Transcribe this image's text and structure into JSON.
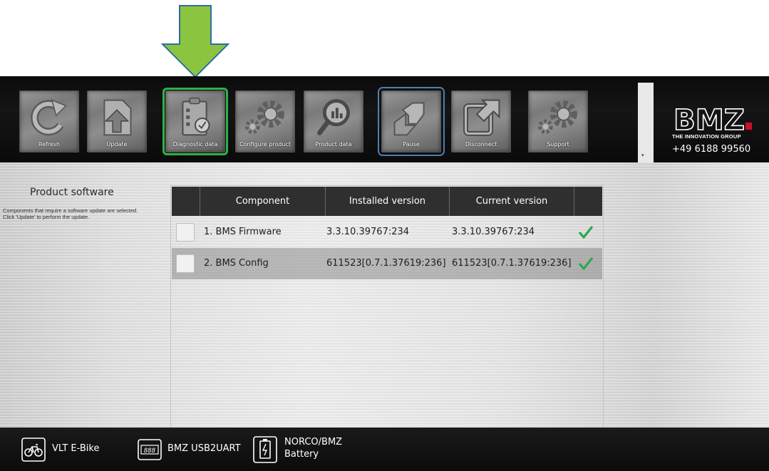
{
  "toolbar": {
    "buttons": [
      {
        "label": "Refresh",
        "icon": "refresh-icon"
      },
      {
        "label": "Update",
        "icon": "update-icon"
      },
      {
        "label": "Diagnostic data",
        "icon": "diagnostic-icon"
      },
      {
        "label": "Configure product",
        "icon": "gears-icon"
      },
      {
        "label": "Product data",
        "icon": "magnifier-chart-icon"
      },
      {
        "label": "Pause",
        "icon": "pause-icon"
      },
      {
        "label": "Disconnect",
        "icon": "disconnect-icon"
      },
      {
        "label": "Support",
        "icon": "gears-icon"
      }
    ],
    "highlight_color": "#2cb34a",
    "pause_outline_color": "#4d7fb0"
  },
  "brand": {
    "logo_text": "BMZ",
    "tagline": "THE INNOVATION GROUP",
    "phone": "+49 6188 99560",
    "accent": "#c8102e"
  },
  "sidebar": {
    "title": "Product software",
    "description": "Components that require a software update are selected. Click 'Update' to perform the update."
  },
  "table": {
    "headers": [
      "",
      "Component",
      "Installed version",
      "Current version",
      ""
    ],
    "rows": [
      {
        "component": "1. BMS Firmware",
        "installed": "3.3.10.39767:234",
        "current": "3.3.10.39767:234",
        "status": "check-icon"
      },
      {
        "component": "2. BMS Config",
        "installed": "611523[0.7.1.37619:236]",
        "current": "611523[0.7.1.37619:236]",
        "status": "check-icon"
      }
    ],
    "check_color": "#2aa84a"
  },
  "statusbar": {
    "devices": [
      {
        "label": "VLT E-Bike",
        "icon": "bike-icon"
      },
      {
        "label": "BMZ USB2UART",
        "icon": "display-888-icon"
      },
      {
        "label": "NORCO/BMZ\nBattery",
        "icon": "battery-icon"
      }
    ]
  },
  "annotation": {
    "arrow_color": "#8bc53f"
  }
}
